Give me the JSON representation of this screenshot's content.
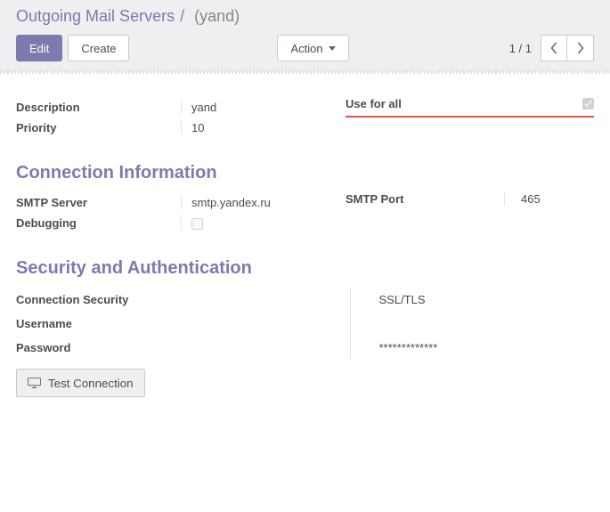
{
  "breadcrumb": {
    "root": "Outgoing Mail Servers",
    "current": "(yand)"
  },
  "toolbar": {
    "edit": "Edit",
    "create": "Create",
    "action": "Action"
  },
  "pager": {
    "text": "1 / 1"
  },
  "fields": {
    "description": {
      "label": "Description",
      "value": "yand"
    },
    "priority": {
      "label": "Priority",
      "value": "10"
    },
    "use_for_all": {
      "label": "Use for all",
      "checked": true
    }
  },
  "sections": {
    "connection": {
      "title": "Connection Information",
      "smtp_server": {
        "label": "SMTP Server",
        "value": "smtp.yandex.ru"
      },
      "smtp_port": {
        "label": "SMTP Port",
        "value": "465"
      },
      "debugging": {
        "label": "Debugging",
        "checked": false
      }
    },
    "security": {
      "title": "Security and Authentication",
      "conn_sec": {
        "label": "Connection Security",
        "value": "SSL/TLS"
      },
      "username": {
        "label": "Username",
        "value": ""
      },
      "password": {
        "label": "Password",
        "value": "*************"
      },
      "test_btn": "Test Connection"
    }
  }
}
